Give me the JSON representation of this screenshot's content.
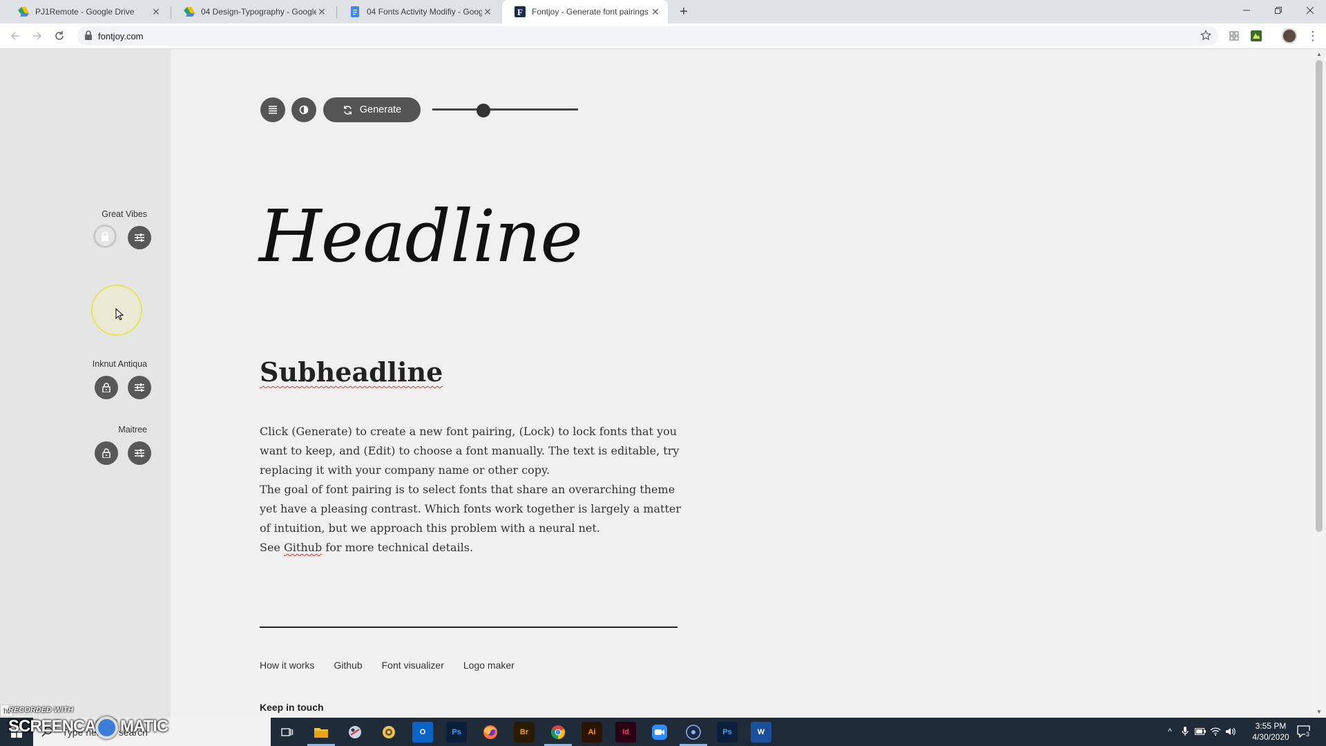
{
  "browser": {
    "tabs": [
      {
        "title": "PJ1Remote - Google Drive",
        "favicon": "google-drive-icon",
        "active": false
      },
      {
        "title": "04 Design-Typography - Google",
        "favicon": "google-drive-icon",
        "active": false
      },
      {
        "title": "04 Fonts Activity Modifiy - Goog",
        "favicon": "google-docs-icon",
        "active": false
      },
      {
        "title": "Fontjoy - Generate font pairings",
        "favicon": "fontjoy-icon",
        "active": true
      }
    ],
    "url": "fontjoy.com"
  },
  "sidebar": {
    "fonts": [
      {
        "name": "Great Vibes",
        "role": "headline",
        "lock_loading": true
      },
      {
        "name": "Inknut Antiqua",
        "role": "subheadline",
        "lock_loading": false
      },
      {
        "name": "Maitree",
        "role": "body",
        "lock_loading": false
      }
    ]
  },
  "controls": {
    "generate_label": "Generate",
    "contrast_slider": 0.35
  },
  "content": {
    "headline": "Headline",
    "subheadline": "Subheadline",
    "para1": "Click (Generate) to create a new font pairing, (Lock) to lock fonts that you want to keep, and (Edit) to choose a font manually. The text is editable, try replacing it with your company name or other copy.",
    "para2": "The goal of font pairing is to select fonts that share an overarching theme yet have a pleasing contrast. Which fonts work together is largely a matter of intuition, but we approach this problem with a neural net.",
    "para3_prefix": "See",
    "para3_link": "Github",
    "para3_suffix": "for more technical details."
  },
  "footer": {
    "links": [
      "How it works",
      "Github",
      "Font visualizer",
      "Logo maker"
    ],
    "keep_in_touch": "Keep in touch"
  },
  "overlays": {
    "hover_url": "ht",
    "recorded_with": "RECORDED WITH",
    "logo_left": "SCREENCAST",
    "logo_right": "MATIC"
  },
  "taskbar": {
    "search_placeholder": "Type here to search",
    "time": "3:55 PM",
    "date": "4/30/2020",
    "notification_count": "3",
    "pinned": [
      "task-view-icon",
      "file-explorer-icon",
      "snipping-tool-icon",
      "settings-icon",
      "outlook-icon",
      "photoshop-icon",
      "firefox-icon",
      "bridge-icon",
      "chrome-icon",
      "illustrator-icon",
      "indesign-icon",
      "zoom-icon",
      "obs-icon",
      "photoshop-icon",
      "word-icon"
    ]
  }
}
